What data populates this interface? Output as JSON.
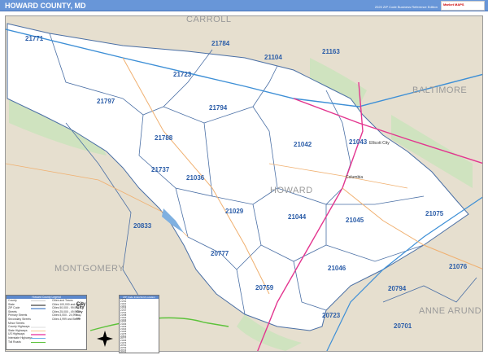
{
  "header": {
    "title": "HOWARD COUNTY, MD",
    "edition": "2020 ZIP Code Business Reference Edition",
    "logo_text": "Market MAPS"
  },
  "regions": {
    "carroll": "CARROLL",
    "baltimore": "BALTIMORE",
    "howard": "HOWARD",
    "montgomery": "MONTGOMERY",
    "anne_arundel": "ANNE ARUNDEL"
  },
  "cities": {
    "columbia": "Columbia",
    "ellicott_city": "Ellicott City"
  },
  "zip_codes": [
    "21771",
    "21784",
    "21104",
    "21163",
    "21723",
    "21797",
    "21794",
    "21788",
    "21042",
    "21043",
    "21737",
    "21036",
    "21029",
    "21044",
    "21045",
    "21075",
    "20833",
    "20777",
    "21046",
    "21076",
    "20794",
    "20759",
    "20723",
    "20701"
  ],
  "legend": {
    "title": "Howard County Legend",
    "items": [
      "County",
      "State",
      "ZIP Code",
      "Streets",
      "Primary Streets",
      "Secondary Streets",
      "Minor Streets",
      "County Highways",
      "State Highways",
      "US Highways",
      "Interstate Highways",
      "Toll Roads"
    ],
    "city_title": "Cities and Towns",
    "cities": [
      "Cities 100,000 and Above",
      "Cities 50,000 - 99,999",
      "Cities 25,000 - 49,999",
      "Cities 5,000 - 24,999",
      "Cities 4,999 and Below"
    ],
    "city_samples": [
      "City",
      "City",
      "City",
      "City",
      "City"
    ]
  },
  "zip_table": {
    "title": "ZIP Code Index/Grid Location"
  },
  "colors": {
    "header": "#6896d8",
    "land": "#e6dfcf",
    "county": "#ffffff",
    "zip_line": "#4a6fa5",
    "interstate": "#e3358f",
    "highway": "#f0b070",
    "park": "#cfe3bf"
  }
}
